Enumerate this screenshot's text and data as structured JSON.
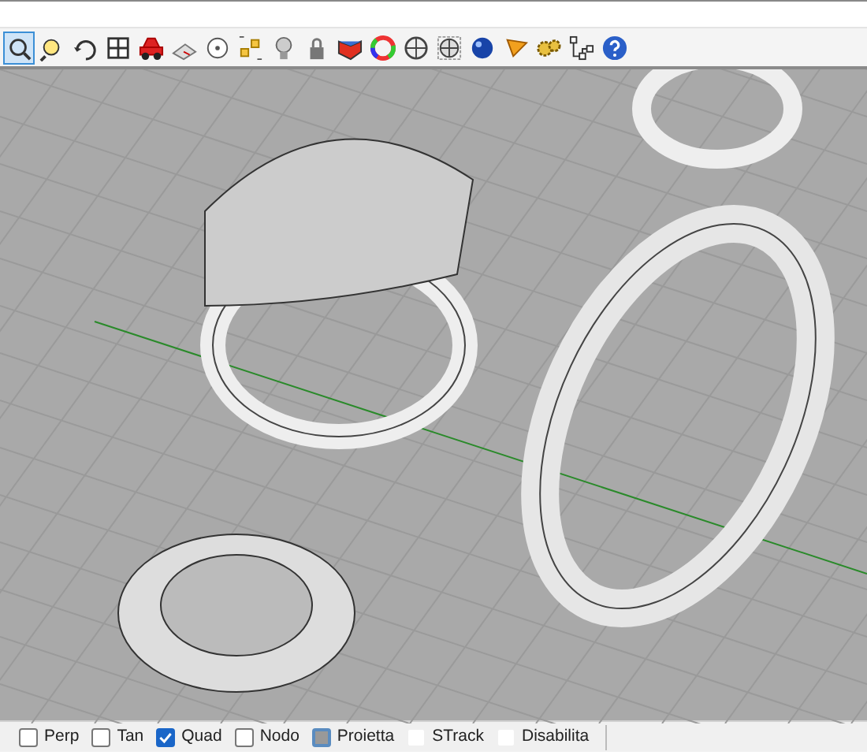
{
  "toolbar": {
    "buttons": [
      {
        "selected": true
      },
      {
        "selected": false
      },
      {
        "selected": false
      },
      {
        "selected": false
      },
      {
        "selected": false
      },
      {
        "selected": false
      },
      {
        "selected": false
      },
      {
        "selected": false
      },
      {
        "selected": false
      },
      {
        "selected": false
      },
      {
        "selected": false
      },
      {
        "selected": false
      },
      {
        "selected": false
      },
      {
        "selected": false
      },
      {
        "selected": false
      },
      {
        "selected": false
      },
      {
        "selected": false
      },
      {
        "selected": false
      }
    ]
  },
  "status_bar": {
    "osnaps": [
      {
        "label": "Perp",
        "kind": "checkbox",
        "checked": false
      },
      {
        "label": "Tan",
        "kind": "checkbox",
        "checked": false
      },
      {
        "label": "Quad",
        "kind": "checkbox",
        "checked": true
      },
      {
        "label": "Nodo",
        "kind": "checkbox",
        "checked": false
      },
      {
        "label": "Proietta",
        "kind": "toggle-button",
        "on": true
      },
      {
        "label": "STrack",
        "kind": "toggle"
      },
      {
        "label": "Disabilita",
        "kind": "toggle"
      }
    ]
  }
}
